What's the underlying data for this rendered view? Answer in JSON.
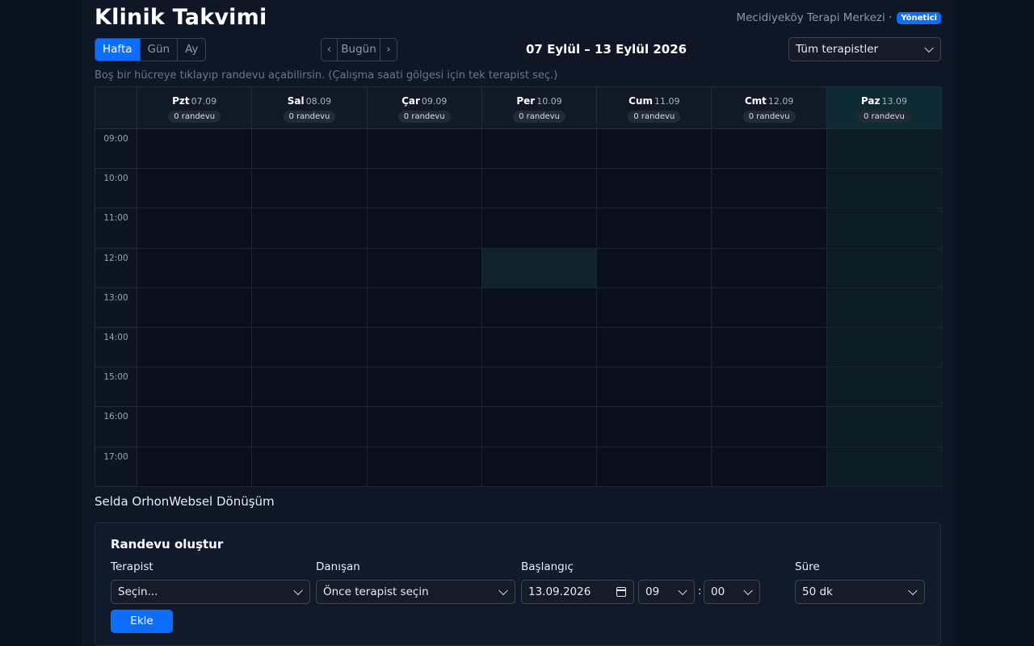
{
  "header": {
    "title": "Klinik Takvimi",
    "org": "Mecidiyeköy Terapi Merkezi ·",
    "role_badge": "Yönetici"
  },
  "view_tabs": [
    {
      "label": "Hafta",
      "active": true
    },
    {
      "label": "Gün",
      "active": false
    },
    {
      "label": "Ay",
      "active": false
    }
  ],
  "nav": {
    "prev": "‹",
    "today": "Bugün",
    "next": "›"
  },
  "date_range": "07 Eylül – 13 Eylül 2026",
  "filter": {
    "selected": "Tüm terapistler"
  },
  "hint": "Boş bir hücreye tıklayıp randevu açabilirsin. (Çalışma saati gölgesi için tek terapist seç.)",
  "calendar": {
    "days": [
      {
        "name": "Pzt",
        "date": "07.09",
        "count": "0 randevu",
        "today": false
      },
      {
        "name": "Sal",
        "date": "08.09",
        "count": "0 randevu",
        "today": false
      },
      {
        "name": "Çar",
        "date": "09.09",
        "count": "0 randevu",
        "today": false
      },
      {
        "name": "Per",
        "date": "10.09",
        "count": "0 randevu",
        "today": false
      },
      {
        "name": "Cum",
        "date": "11.09",
        "count": "0 randevu",
        "today": false
      },
      {
        "name": "Cmt",
        "date": "12.09",
        "count": "0 randevu",
        "today": false
      },
      {
        "name": "Paz",
        "date": "13.09",
        "count": "0 randevu",
        "today": true
      }
    ],
    "hours": [
      "09:00",
      "10:00",
      "11:00",
      "12:00",
      "13:00",
      "14:00",
      "15:00",
      "16:00",
      "17:00"
    ],
    "highlight": {
      "day": 3,
      "hour": 3
    }
  },
  "therapist_text": "Selda OrhonWebsel Dönüşüm",
  "form": {
    "title": "Randevu oluştur",
    "labels": {
      "therapist": "Terapist",
      "client": "Danışan",
      "start": "Başlangıç",
      "duration": "Süre"
    },
    "therapist_value": "Seçin...",
    "client_value": "Önce terapist seçin",
    "date_value": "13.09.2026",
    "hour_value": "09",
    "minute_value": "00",
    "colon": ":",
    "duration_value": "50 dk",
    "submit": "Ekle"
  },
  "colors": {
    "accent": "#0d6efd",
    "today_col": "#0b1d23"
  }
}
